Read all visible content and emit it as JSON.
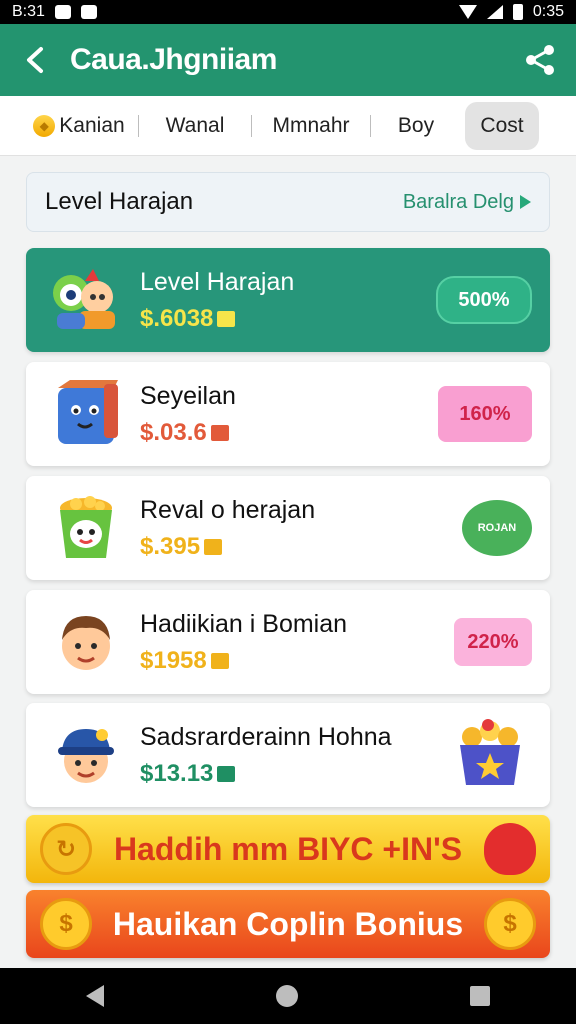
{
  "status_bar": {
    "time_left": "B:31",
    "time_right": "0:35"
  },
  "app_bar": {
    "title": "Caua.Jhgniiam"
  },
  "tabs": [
    {
      "label": "Kanian"
    },
    {
      "label": "Wanal"
    },
    {
      "label": "Mmnahr"
    },
    {
      "label": "Boy"
    },
    {
      "label": "Cost"
    }
  ],
  "header": {
    "label": "Level Harajan",
    "link": "Baralra Delg"
  },
  "cards": [
    {
      "name": "Level Harajan",
      "price": "$.6038",
      "badge": "500%",
      "price_color": "#f6e54a",
      "badge_color": "#2fb287",
      "badge_text_color": "#ffffff"
    },
    {
      "name": "Seyeilan",
      "price": "$.03.6",
      "badge": "160%",
      "price_color": "#e25a3a",
      "badge_color": "#f99fd1",
      "badge_text_color": "#d0234a"
    },
    {
      "name": "Reval o herajan",
      "price": "$.395",
      "badge": "ROJAN",
      "price_color": "#f0b21b",
      "badge_color": "#49b15a",
      "badge_text_color": "#ffffff"
    },
    {
      "name": "Hadiikian i Bomian",
      "price": "$1958",
      "badge": "220%",
      "price_color": "#f0b21b",
      "badge_color": "#fbb3dc",
      "badge_text_color": "#d0234a"
    },
    {
      "name": "Sadsrarderainn Hohna",
      "price": "$13.13",
      "badge": "",
      "price_color": "#1f8f63",
      "badge_color": "#f1b526",
      "badge_text_color": "#ffffff"
    }
  ],
  "banners": [
    {
      "text": "Haddih mm BIYC +IN'S"
    },
    {
      "text": "Hauikan Coplin Bonius"
    }
  ],
  "icons": {
    "back": "arrow-left-icon",
    "share": "share-icon",
    "nav_back": "triangle-back-icon",
    "nav_home": "circle-home-icon",
    "nav_recent": "square-recent-icon"
  },
  "colors": {
    "primary": "#23946f",
    "featured": "#27967a",
    "banner_yellow": "#f5c40d",
    "banner_orange": "#f05a1e"
  }
}
